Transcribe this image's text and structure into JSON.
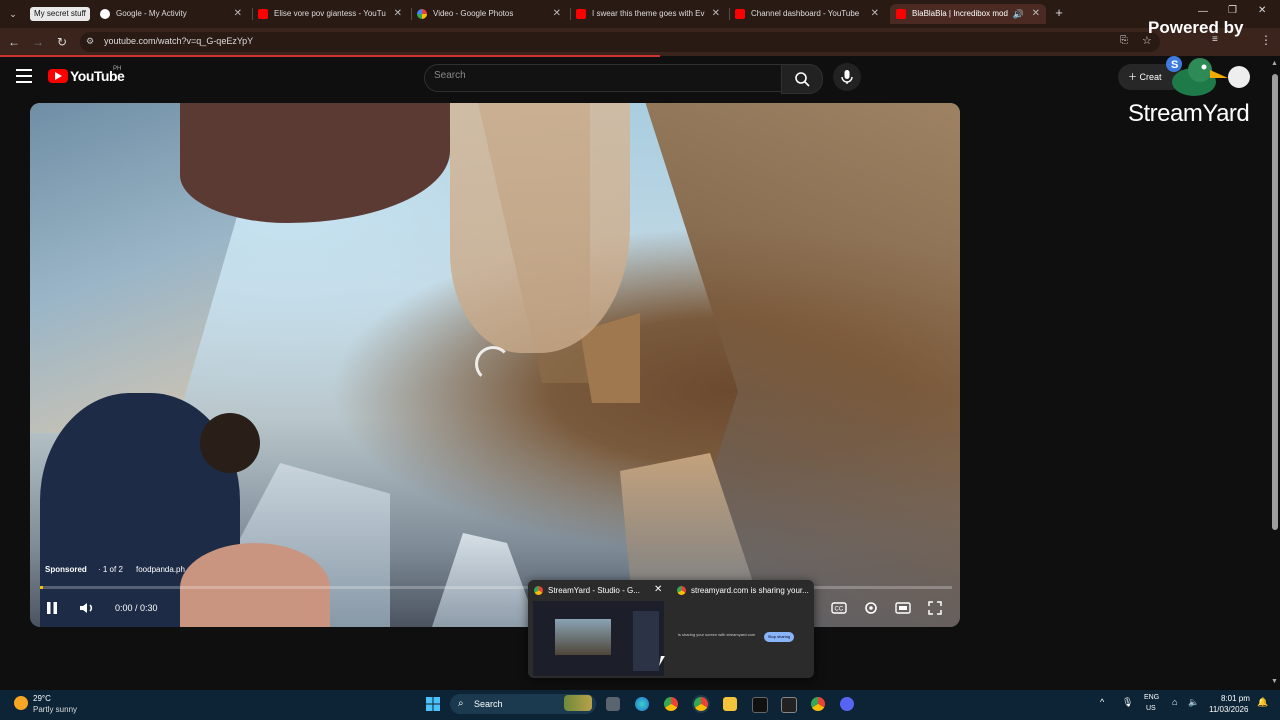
{
  "browser": {
    "tab_group_label": "My secret stuff",
    "tabs": [
      {
        "label": "Google - My Activity",
        "icon": "google-icon"
      },
      {
        "label": "Elise vore pov giantess - YouTu",
        "icon": "youtube-icon"
      },
      {
        "label": "Video - Google Photos",
        "icon": "google-photos-icon"
      },
      {
        "label": "I swear this theme goes with Ev",
        "icon": "youtube-icon"
      },
      {
        "label": "Channel dashboard - YouTube",
        "icon": "youtube-icon"
      },
      {
        "label": "BlaBlaBla | Incredibox mod",
        "icon": "youtube-icon",
        "active": true
      }
    ],
    "url": "youtube.com/watch?v=q_G-qeEzYpY"
  },
  "youtube": {
    "logo_text": "YouTube",
    "country_code": "PH",
    "search_placeholder": "Search",
    "create_label": "Creat"
  },
  "overlay": {
    "powered_by": "Powered by",
    "brand": "StreamYard"
  },
  "player": {
    "sponsored": "Sponsored",
    "ad_count": "· 1 of 2",
    "advertiser": "foodpanda.ph",
    "time": "0:00 / 0:30",
    "progress_fraction": 0.003
  },
  "preview": {
    "window_title": "StreamYard - Studio - G...",
    "share_title": "streamyard.com is sharing your...",
    "share_text": "is sharing your screen with streamyard.com",
    "stop_label": "Stop sharing"
  },
  "taskbar": {
    "temperature": "29°C",
    "weather": "Partly sunny",
    "search_label": "Search",
    "lang_line1": "ENG",
    "lang_line2": "US",
    "time": "8:01 pm",
    "date": "11/03/2026"
  },
  "colors": {
    "youtube_red": "#ff0000",
    "progress_yellow": "#f6c000",
    "taskbar": "#0c2436"
  }
}
